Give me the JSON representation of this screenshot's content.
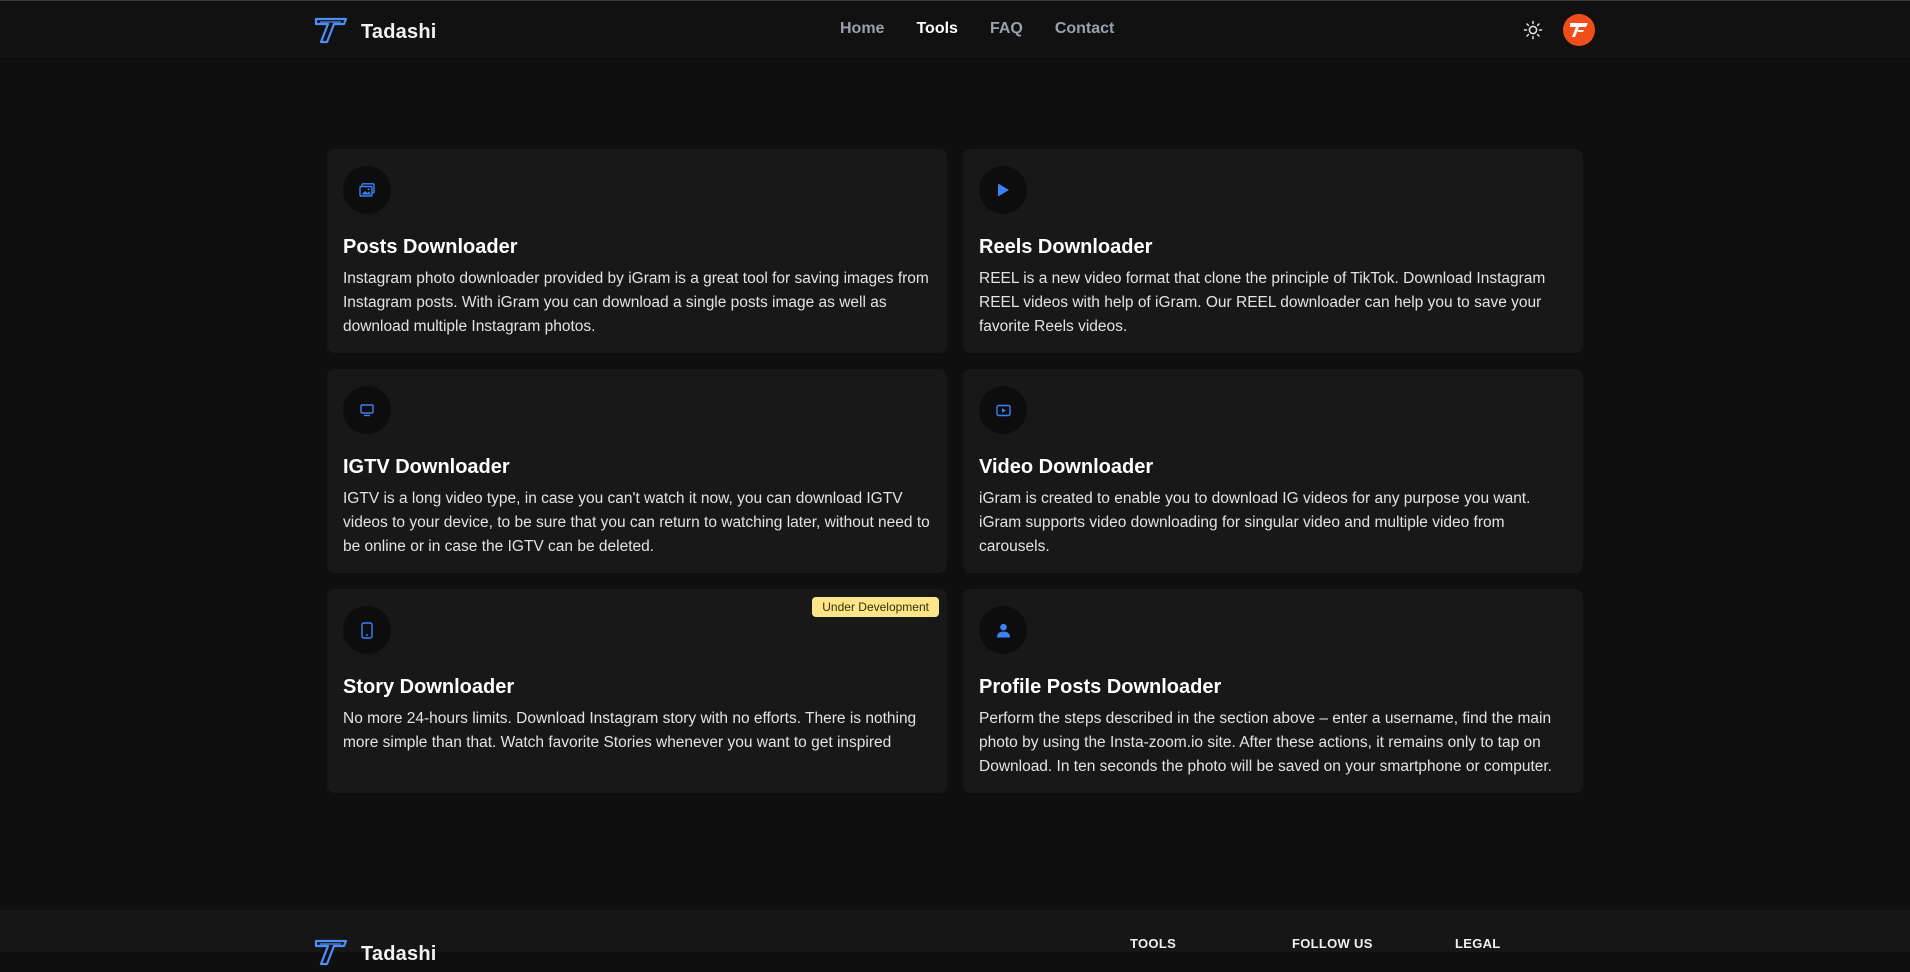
{
  "header": {
    "brand": "Tadashi",
    "nav": [
      {
        "label": "Home",
        "active": false
      },
      {
        "label": "Tools",
        "active": true
      },
      {
        "label": "FAQ",
        "active": false
      },
      {
        "label": "Contact",
        "active": false
      }
    ],
    "theme_icon": "sun-icon",
    "avatar_icon": "brand-logo-icon"
  },
  "colors": {
    "accent": "#3b82f6",
    "badge": "#fde68a",
    "avatar": "#ef4e1a"
  },
  "cards": [
    {
      "icon": "image-icon",
      "title": "Posts Downloader",
      "text": "Instagram photo downloader provided by iGram is a great tool for saving images from Instagram posts. With iGram you can download a single posts image as well as download multiple Instagram photos."
    },
    {
      "icon": "play-icon",
      "title": "Reels Downloader",
      "text": "REEL is a new video format that clone the principle of TikTok. Download Instagram REEL videos with help of iGram. Our REEL downloader can help you to save your favorite Reels videos."
    },
    {
      "icon": "tv-icon",
      "title": "IGTV Downloader",
      "text": "IGTV is a long video type, in case you can't watch it now, you can download IGTV videos to your device, to be sure that you can return to watching later, without need to be online or in case the IGTV can be deleted."
    },
    {
      "icon": "video-icon",
      "title": "Video Downloader",
      "text": "iGram is created to enable you to download IG videos for any purpose you want. iGram supports video downloading for singular video and multiple video from carousels."
    },
    {
      "icon": "phone-icon",
      "title": "Story Downloader",
      "text": "No more 24-hours limits. Download Instagram story with no efforts. There is nothing more simple than that. Watch favorite Stories whenever you want to get inspired",
      "badge": "Under Development"
    },
    {
      "icon": "user-icon",
      "title": "Profile Posts Downloader",
      "text": "Perform the steps described in the section above – enter a username, find the main photo by using the Insta-zoom.io site. After these actions, it remains only to tap on Download. In ten seconds the photo will be saved on your smartphone or computer."
    }
  ],
  "footer": {
    "brand": "Tadashi",
    "headings": [
      "TOOLS",
      "FOLLOW US",
      "LEGAL"
    ]
  }
}
